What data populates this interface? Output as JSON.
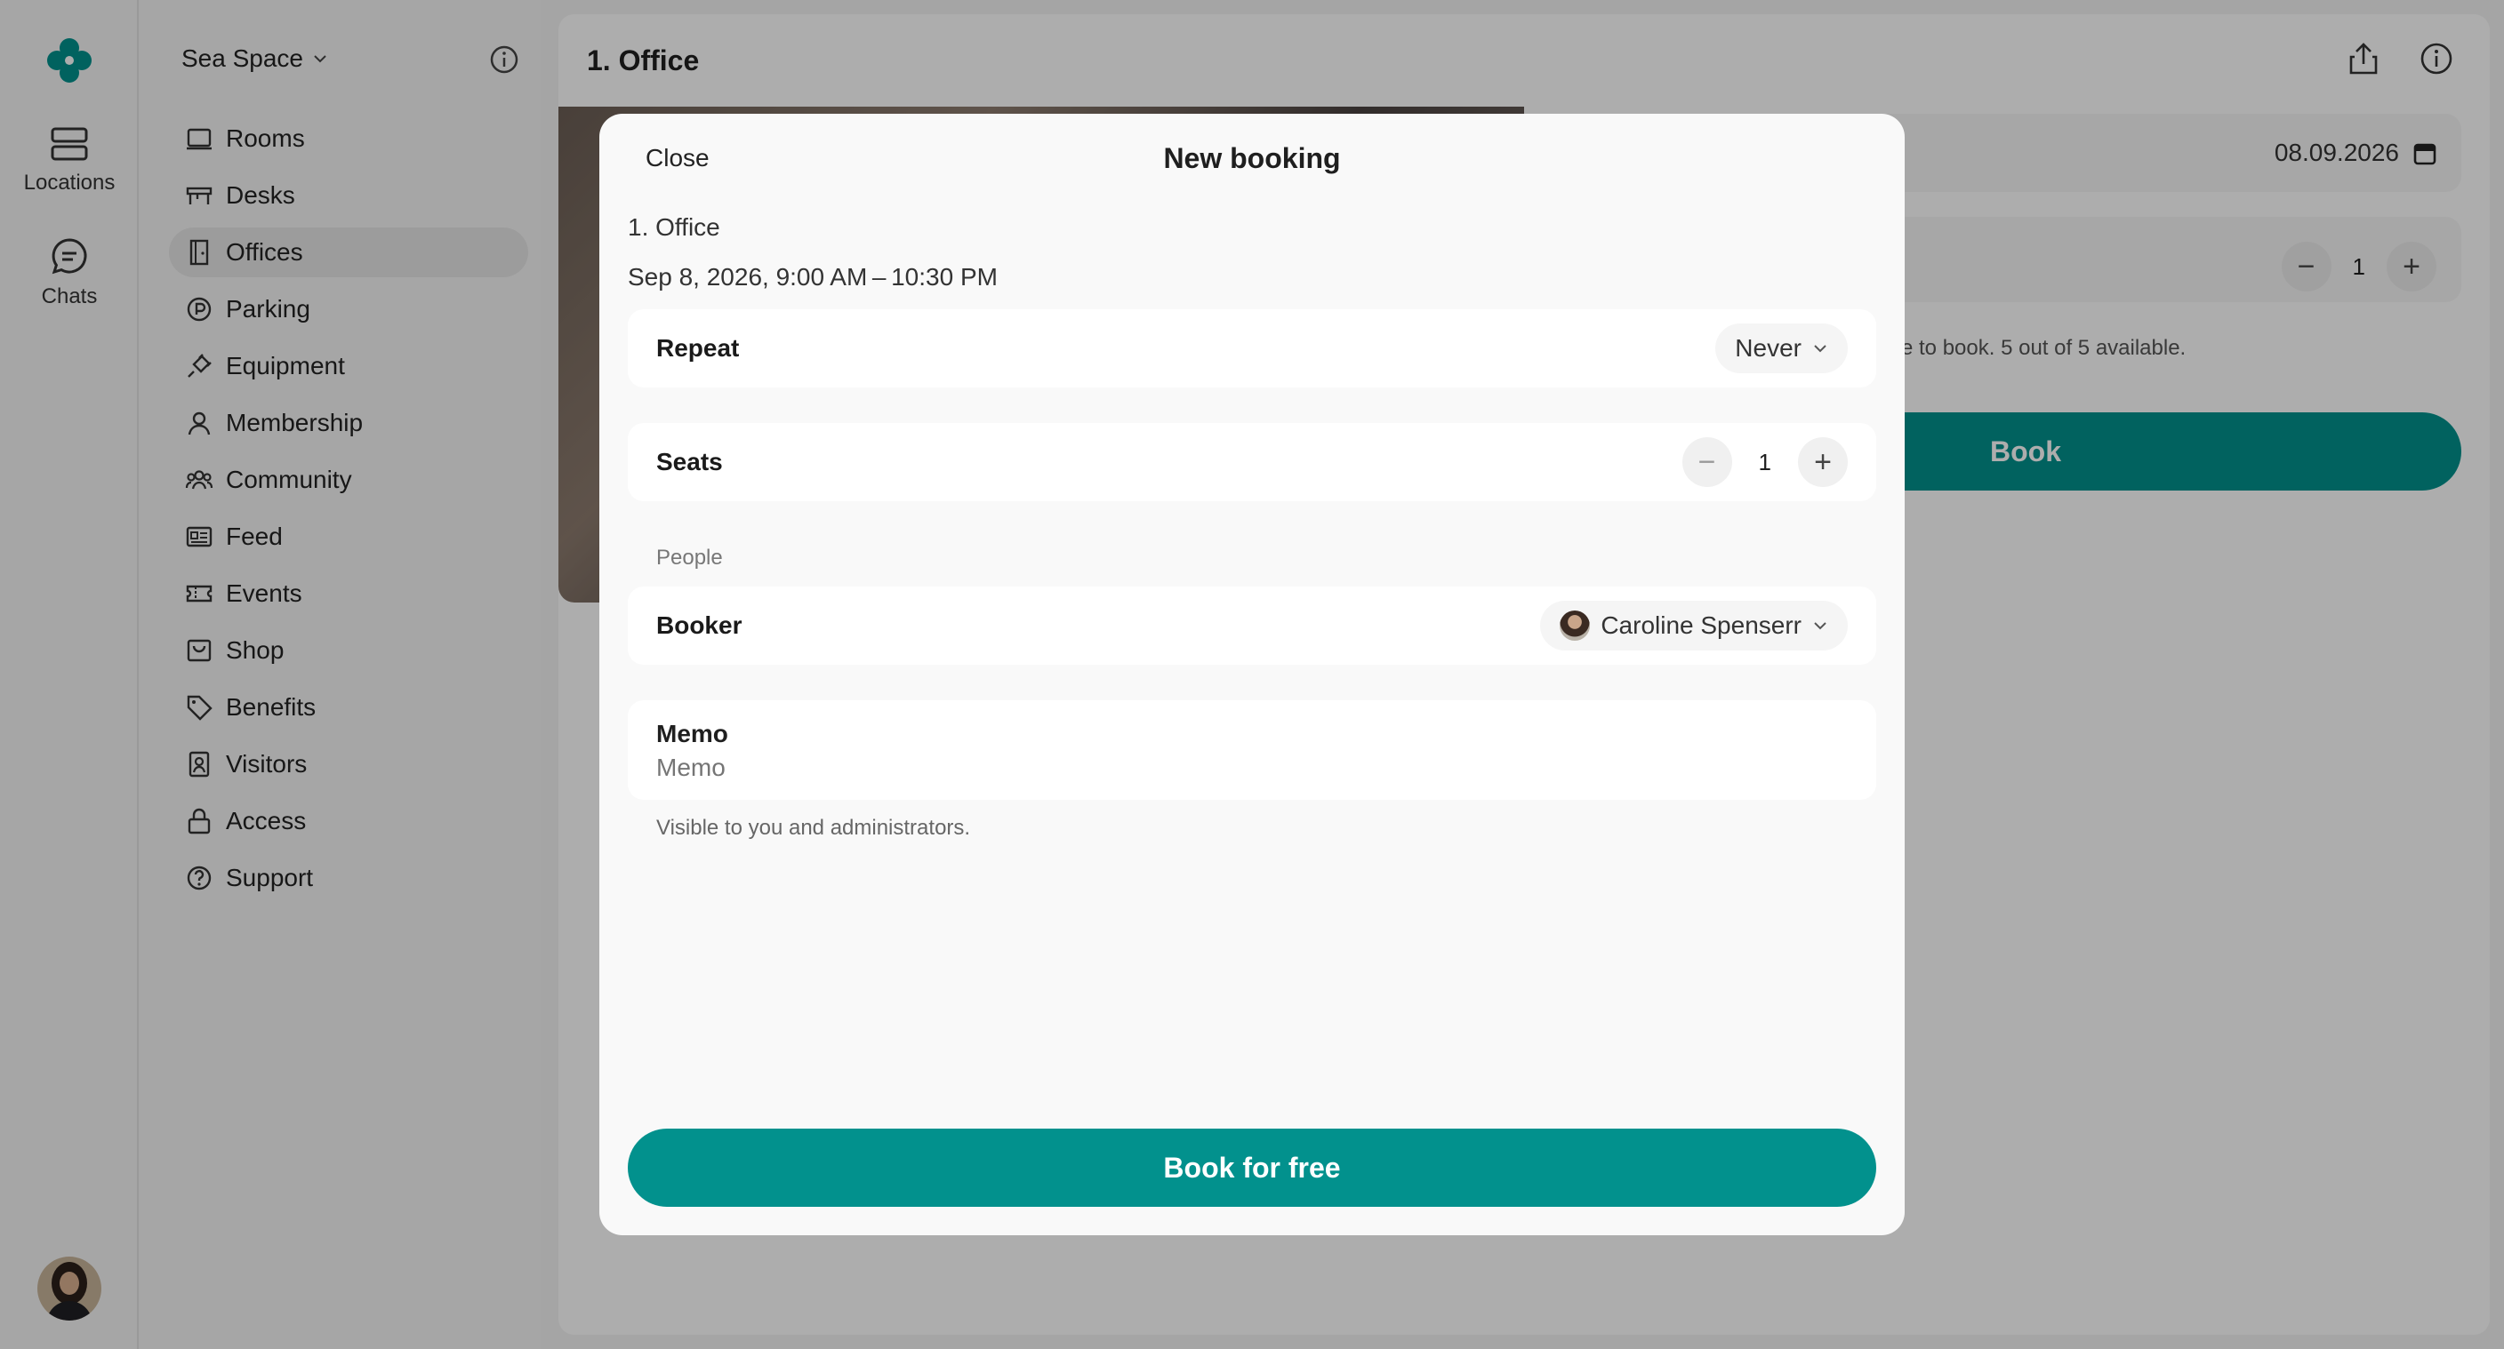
{
  "rail": {
    "items": [
      {
        "label": "Locations",
        "icon": "locations-icon"
      },
      {
        "label": "Chats",
        "icon": "chat-icon"
      }
    ]
  },
  "nav": {
    "space_name": "Sea Space",
    "items": [
      {
        "label": "Rooms",
        "icon": "rooms-icon"
      },
      {
        "label": "Desks",
        "icon": "desks-icon"
      },
      {
        "label": "Offices",
        "icon": "offices-icon",
        "active": true
      },
      {
        "label": "Parking",
        "icon": "parking-icon"
      },
      {
        "label": "Equipment",
        "icon": "equipment-icon"
      },
      {
        "label": "Membership",
        "icon": "membership-icon"
      },
      {
        "label": "Community",
        "icon": "community-icon"
      },
      {
        "label": "Feed",
        "icon": "feed-icon"
      },
      {
        "label": "Events",
        "icon": "events-icon"
      },
      {
        "label": "Shop",
        "icon": "shop-icon"
      },
      {
        "label": "Benefits",
        "icon": "benefits-icon"
      },
      {
        "label": "Visitors",
        "icon": "visitors-icon"
      },
      {
        "label": "Access",
        "icon": "access-icon"
      },
      {
        "label": "Support",
        "icon": "support-icon"
      }
    ]
  },
  "main": {
    "title": "1. Office",
    "date": "08.09.2026",
    "seats": "1",
    "availability_text": "e to book. 5 out of 5 available.",
    "book_label": "Book"
  },
  "modal": {
    "close_label": "Close",
    "title": "New booking",
    "resource": "1. Office",
    "datetime": "Sep 8, 2026, 9:00 AM – 10:30 PM",
    "repeat": {
      "label": "Repeat",
      "value": "Never"
    },
    "seats": {
      "label": "Seats",
      "value": "1"
    },
    "people_section": "People",
    "booker": {
      "label": "Booker",
      "value": "Caroline Spenserr"
    },
    "memo": {
      "label": "Memo",
      "placeholder": "Memo",
      "hint": "Visible to you and administrators."
    },
    "submit_label": "Book for free"
  },
  "colors": {
    "accent": "#02918d",
    "overlay": "rgba(0,0,0,0.32)"
  }
}
